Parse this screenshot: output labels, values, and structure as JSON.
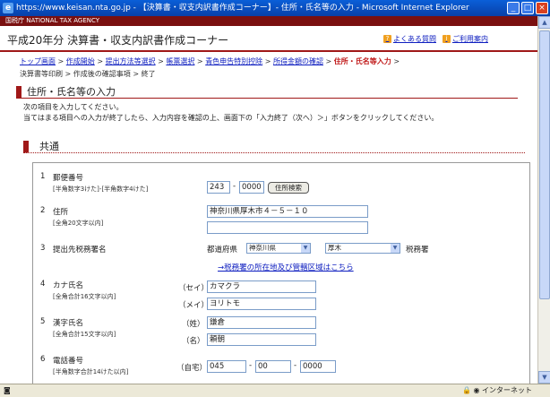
{
  "window": {
    "title": "https://www.keisan.nta.go.jp - 【決算書・収支内訳書作成コーナー】- 住所・氏名等の入力 - Microsoft Internet Explorer"
  },
  "header": {
    "agency": "国税庁 NATIONAL TAX AGENCY",
    "title": "平成20年分 決算書・収支内訳書作成コーナー",
    "faq": "よくある質問",
    "guide": "ご利用案内"
  },
  "breadcrumb": {
    "items": [
      "トップ画面",
      "作成開始",
      "提出方法等選択",
      "帳票選択",
      "青色申告特別控除",
      "所得金額の確認"
    ],
    "current": "住所・氏名等入力",
    "rest": [
      "決算書等印刷",
      "作成後の確認事項",
      "終了"
    ]
  },
  "page": {
    "section_title": "住所・氏名等の入力",
    "intro1": "次の項目を入力してください。",
    "intro2": "当てはまる項目への入力が終了したら、入力内容を確認の上、画面下の「入力終了（次へ）＞」ボタンをクリックしてください。",
    "sub_title": "共通"
  },
  "form": {
    "postal": {
      "num": "1",
      "label": "郵便番号",
      "note": "[半角数字3けた]-[半角数字4けた]",
      "v1": "243",
      "v2": "0000",
      "search": "住所検索"
    },
    "address": {
      "num": "2",
      "label": "住所",
      "note": "[全角20文字以内]",
      "value": "神奈川県厚木市４－５－１０",
      "value2": ""
    },
    "office": {
      "num": "3",
      "label": "提出先税務署名",
      "pref_label": "都道府県",
      "pref": "神奈川県",
      "office": "厚木",
      "suffix": "税務署",
      "link": "→税務署の所在地及び管轄区域はこちら"
    },
    "kana": {
      "num": "4",
      "label": "カナ氏名",
      "note": "[全角合計16文字以内]",
      "sei_label": "（セイ）",
      "sei": "カマクラ",
      "mei_label": "（メイ）",
      "mei": "ヨリトモ"
    },
    "kanji": {
      "num": "5",
      "label": "漢字氏名",
      "note": "[全角合計15文字以内]",
      "sei_label": "（姓）",
      "sei": "鎌倉",
      "mei_label": "（名）",
      "mei": "頼朝"
    },
    "phone": {
      "num": "6",
      "label": "電話番号",
      "note": "[半角数字合計14けた以内]",
      "home_label": "（自宅）",
      "p1": "045",
      "p2": "00",
      "p3": "0000"
    }
  },
  "status": {
    "zone": "インターネット"
  }
}
